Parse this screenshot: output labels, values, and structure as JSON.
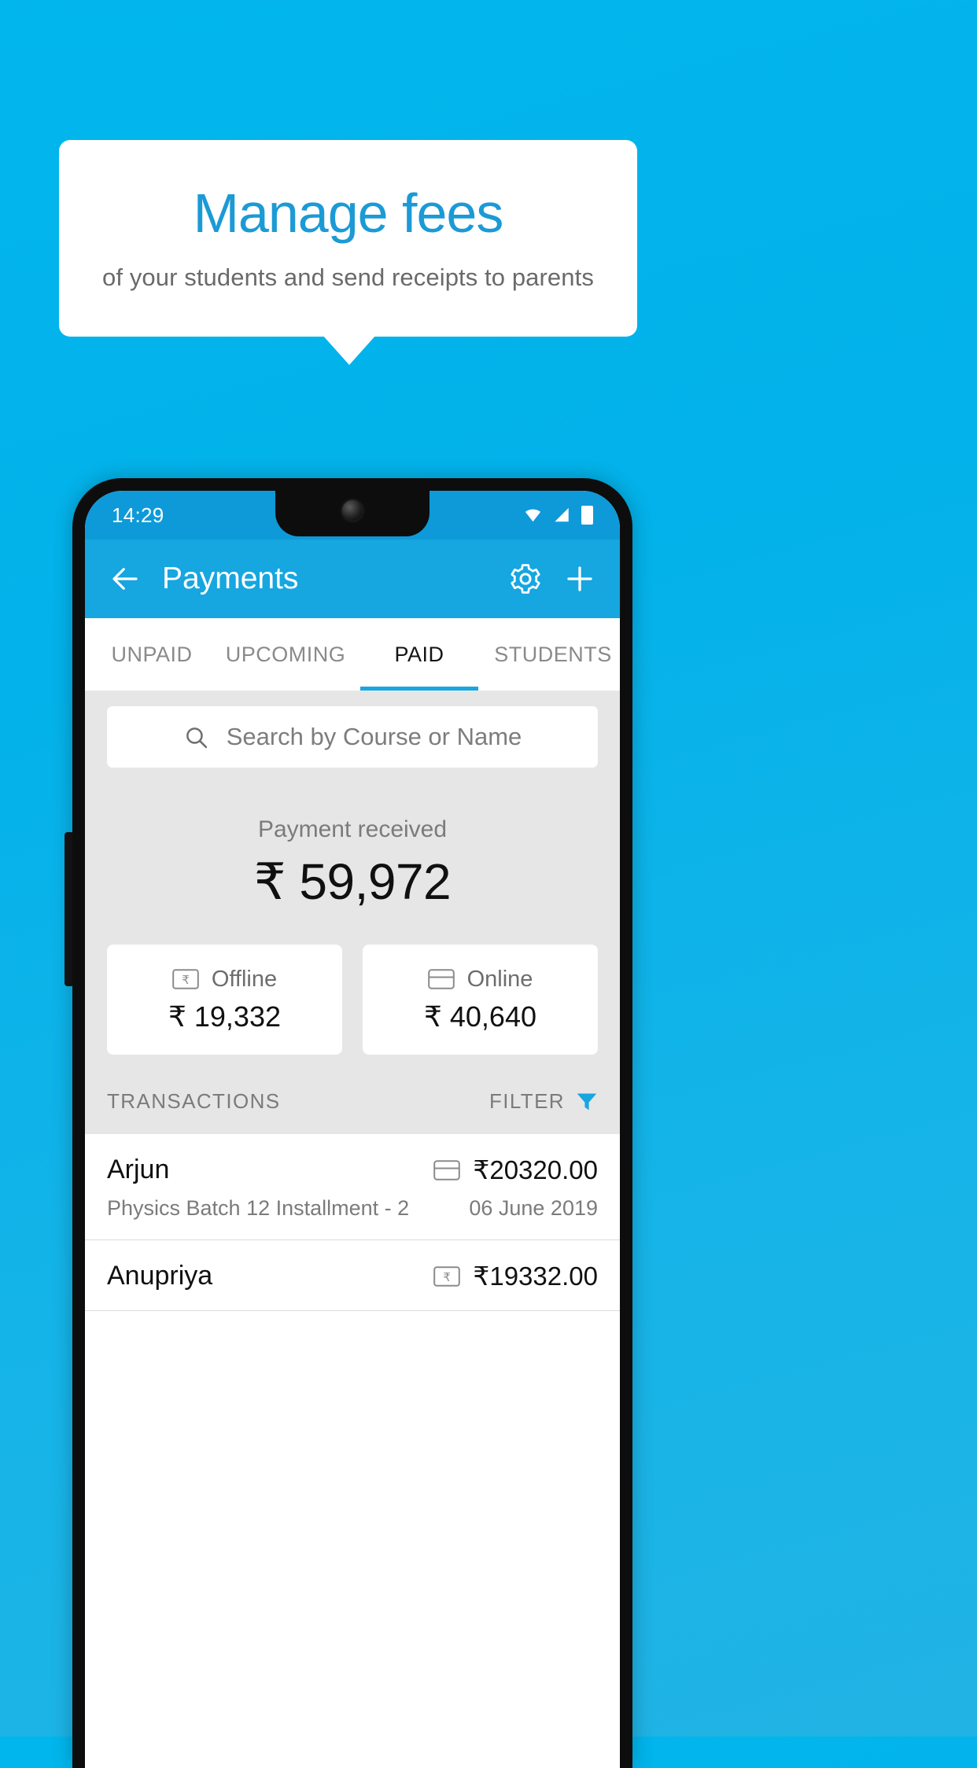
{
  "promo": {
    "title": "Manage fees",
    "subtitle": "of your students and send receipts to parents"
  },
  "colors": {
    "background": "#03b2ea",
    "accent": "#16a6e0",
    "promo_title": "#1b9ad6",
    "status_bar": "#0e9ad8",
    "sheet": "#e6e6e6"
  },
  "phone": {
    "status_bar": {
      "time": "14:29",
      "icons": [
        "wifi-icon",
        "signal-icon",
        "battery-icon"
      ]
    },
    "app_bar": {
      "back_icon": "back-arrow-icon",
      "title": "Payments",
      "settings_icon": "gear-icon",
      "add_icon": "plus-icon"
    },
    "tabs": [
      {
        "label": "UNPAID",
        "active": false
      },
      {
        "label": "UPCOMING",
        "active": false
      },
      {
        "label": "PAID",
        "active": true
      },
      {
        "label": "STUDENTS",
        "active": false
      }
    ],
    "search": {
      "placeholder": "Search by Course or Name",
      "value": "",
      "icon": "search-icon"
    },
    "summary": {
      "label": "Payment received",
      "amount": "₹ 59,972"
    },
    "method_cards": [
      {
        "label": "Offline",
        "amount": "₹ 19,332",
        "icon": "rupee-note-icon"
      },
      {
        "label": "Online",
        "amount": "₹ 40,640",
        "icon": "credit-card-icon"
      }
    ],
    "list_header": {
      "transactions_label": "TRANSACTIONS",
      "filter_label": "FILTER",
      "filter_icon": "filter-funnel-icon"
    },
    "transactions": [
      {
        "name": "Arjun",
        "amount": "₹20320.00",
        "description": "Physics Batch 12 Installment - 2",
        "date": "06 June 2019",
        "method_icon": "credit-card-icon"
      },
      {
        "name": "Anupriya",
        "amount": "₹19332.00",
        "description": "",
        "date": "",
        "method_icon": "rupee-note-icon"
      }
    ]
  }
}
